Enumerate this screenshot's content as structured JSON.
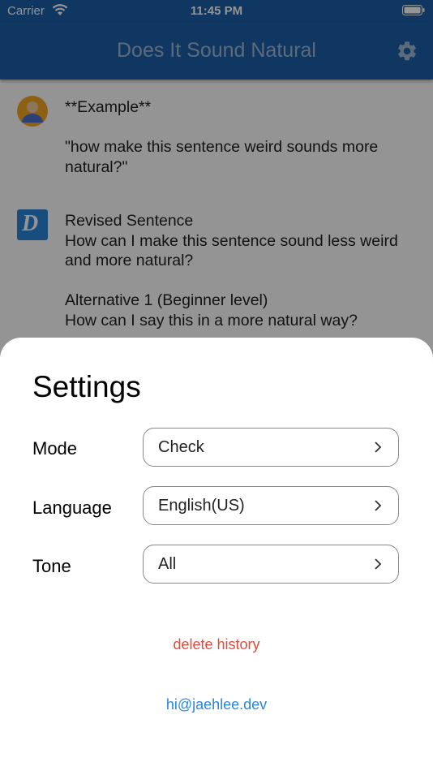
{
  "status_bar": {
    "carrier": "Carrier",
    "time": "11:45 PM"
  },
  "navbar": {
    "title": "Does It Sound Natural",
    "settings_icon": "gear-icon"
  },
  "messages": [
    {
      "sender": "user",
      "text": "**Example**\n\n\"how make this sentence weird sounds more natural?\""
    },
    {
      "sender": "assistant",
      "avatar_letter": "D",
      "text": "Revised Sentence\nHow can I make this sentence sound less weird and more natural?\n\nAlternative 1 (Beginner level)\nHow can I say this in a more natural way?"
    }
  ],
  "settings": {
    "title": "Settings",
    "rows": [
      {
        "label": "Mode",
        "value": "Check"
      },
      {
        "label": "Language",
        "value": "English(US)"
      },
      {
        "label": "Tone",
        "value": "All"
      }
    ],
    "delete_history_label": "delete history",
    "contact_email": "hi@jaehlee.dev"
  },
  "colors": {
    "nav_bar": "#1c5fa8",
    "delete": "#e04a3c",
    "link": "#2a86d8"
  }
}
